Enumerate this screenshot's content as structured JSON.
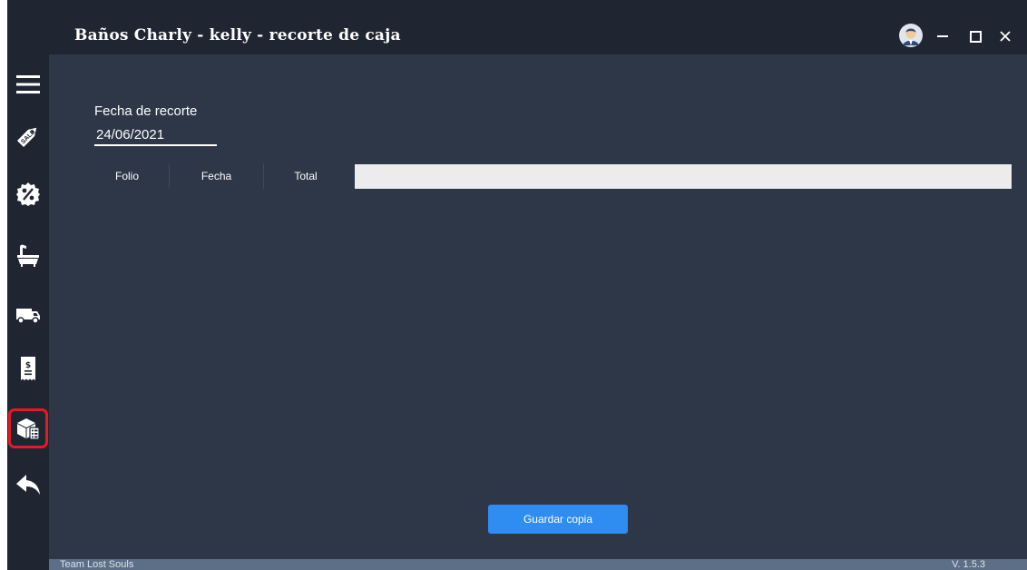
{
  "window": {
    "title": "Baños Charly - kelly - recorte de caja",
    "icons": {
      "avatar": "user-avatar-icon",
      "minimize": "minimize-icon",
      "maximize": "maximize-icon",
      "close": "close-icon"
    }
  },
  "sidebar": {
    "items": [
      {
        "name": "menu",
        "icon": "hamburger-menu-icon"
      },
      {
        "name": "sale",
        "icon": "sale-tag-icon",
        "text": "SALE"
      },
      {
        "name": "discounts",
        "icon": "percent-badge-icon"
      },
      {
        "name": "bathtub",
        "icon": "bathtub-icon"
      },
      {
        "name": "delivery",
        "icon": "delivery-truck-icon"
      },
      {
        "name": "receipt",
        "icon": "receipt-dollar-icon"
      },
      {
        "name": "inventory",
        "icon": "inventory-boxes-icon",
        "active": true
      },
      {
        "name": "back",
        "icon": "back-arrow-icon"
      }
    ],
    "active_color": "#e31c24"
  },
  "form": {
    "date_label": "Fecha de recorte",
    "date_value": "24/06/2021"
  },
  "table": {
    "columns": [
      "Folio",
      "Fecha",
      "Total"
    ],
    "rows": []
  },
  "actions": {
    "save_label": "Guardar copia"
  },
  "status": {
    "left": "Team Lost Souls",
    "version": "V. 1.5.3"
  },
  "colors": {
    "background": "#2d3748",
    "sidebar": "#1f2632",
    "accent": "#2f8cf0",
    "statusbar": "#5c6f86"
  }
}
